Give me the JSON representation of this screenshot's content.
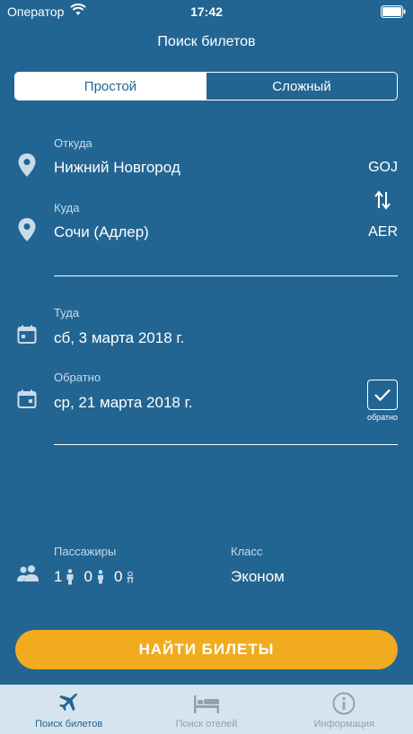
{
  "status_bar": {
    "carrier": "Оператор",
    "time": "17:42"
  },
  "nav": {
    "title": "Поиск билетов"
  },
  "segments": {
    "simple": "Простой",
    "complex": "Сложный",
    "selected": "simple"
  },
  "route": {
    "from_label": "Откуда",
    "from_city": "Нижний Новгород",
    "from_code": "GOJ",
    "to_label": "Куда",
    "to_city": "Сочи (Адлер)",
    "to_code": "AER",
    "swap_icon": "swap-vertical-icon"
  },
  "dates": {
    "depart_label": "Туда",
    "depart_value": "сб, 3 марта 2018 г.",
    "return_label": "Обратно",
    "return_value": "ср, 21 марта 2018 г.",
    "return_checked": true,
    "return_checkbox_caption": "обратно"
  },
  "passengers": {
    "label": "Пассажиры",
    "adults": "1",
    "children": "0",
    "infants": "0"
  },
  "class": {
    "label": "Класс",
    "value": "Эконом"
  },
  "search_button": {
    "label": "НАЙТИ БИЛЕТЫ"
  },
  "tab_bar": {
    "tabs": [
      {
        "label": "Поиск билетов",
        "icon": "airplane-icon",
        "active": true
      },
      {
        "label": "Поиск отелей",
        "icon": "bed-icon",
        "active": false
      },
      {
        "label": "Информация",
        "icon": "info-icon",
        "active": false
      }
    ]
  },
  "colors": {
    "background": "#236592",
    "accent_button": "#f0ab1f",
    "tab_bar": "#d5e4ef",
    "tab_active": "#236592",
    "tab_inactive": "#8ea2b3"
  }
}
